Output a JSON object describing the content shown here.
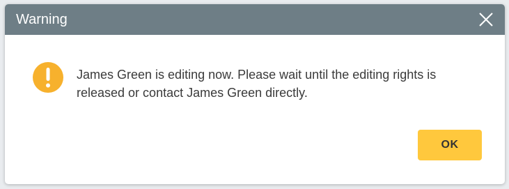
{
  "dialog": {
    "title": "Warning",
    "message": "James Green is editing now. Please wait until the editing rights is released or contact James Green directly.",
    "ok_label": "OK",
    "icons": {
      "close": "close-icon",
      "status": "warning-exclamation-icon"
    },
    "colors": {
      "titlebar": "#6e7e86",
      "warning_icon": "#f7b12d",
      "ok_button": "#ffc83d"
    }
  }
}
